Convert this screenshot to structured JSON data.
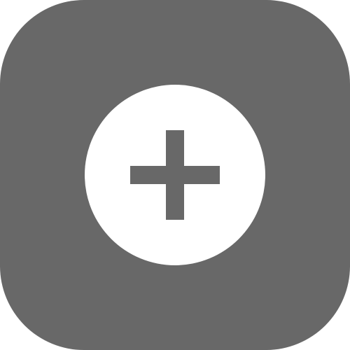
{
  "icon": {
    "name": "add-icon",
    "tile_color": "#686868",
    "circle_color": "#ffffff",
    "plus_color": "#686868"
  }
}
